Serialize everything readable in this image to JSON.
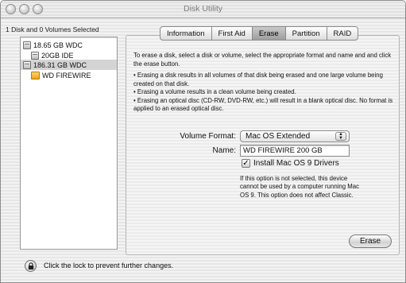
{
  "window": {
    "title": "Disk Utility"
  },
  "sidebar": {
    "selection_summary": "1 Disk and 0 Volumes Selected",
    "items": [
      {
        "label": "18.65 GB WDC",
        "icon": "hard-disk-icon"
      },
      {
        "label": "20GB IDE",
        "icon": "hard-disk-icon"
      },
      {
        "label": "186.31 GB WDC",
        "icon": "hard-disk-icon",
        "selected": true
      },
      {
        "label": "WD FIREWIRE",
        "icon": "firewire-disk-icon"
      }
    ]
  },
  "tabs": [
    {
      "label": "Information"
    },
    {
      "label": "First Aid"
    },
    {
      "label": "Erase",
      "active": true
    },
    {
      "label": "Partition"
    },
    {
      "label": "RAID"
    }
  ],
  "erase": {
    "intro": "To erase a disk, select a disk or volume, select the appropriate format and name and and click the erase button.",
    "bullets": [
      "• Erasing a disk results in all volumes of that disk being erased and one large volume being created on that disk.",
      "• Erasing a volume results in a clean volume being created.",
      "• Erasing an optical disc (CD-RW, DVD-RW, etc.) will result in a blank optical disc. No format is applied to an erased optical disc."
    ],
    "volume_format_label": "Volume Format:",
    "volume_format_value": "Mac OS Extended",
    "name_label": "Name:",
    "name_value": "WD FIREWIRE 200 GB",
    "install_drivers_label": "Install Mac OS 9 Drivers",
    "install_drivers_checked": true,
    "drivers_note": "If this option is not selected, this device cannot be used by a computer running Mac OS 9.  This option does not affect Classic.",
    "erase_button": "Erase"
  },
  "footer": {
    "lock_text": "Click the lock to prevent further changes."
  }
}
